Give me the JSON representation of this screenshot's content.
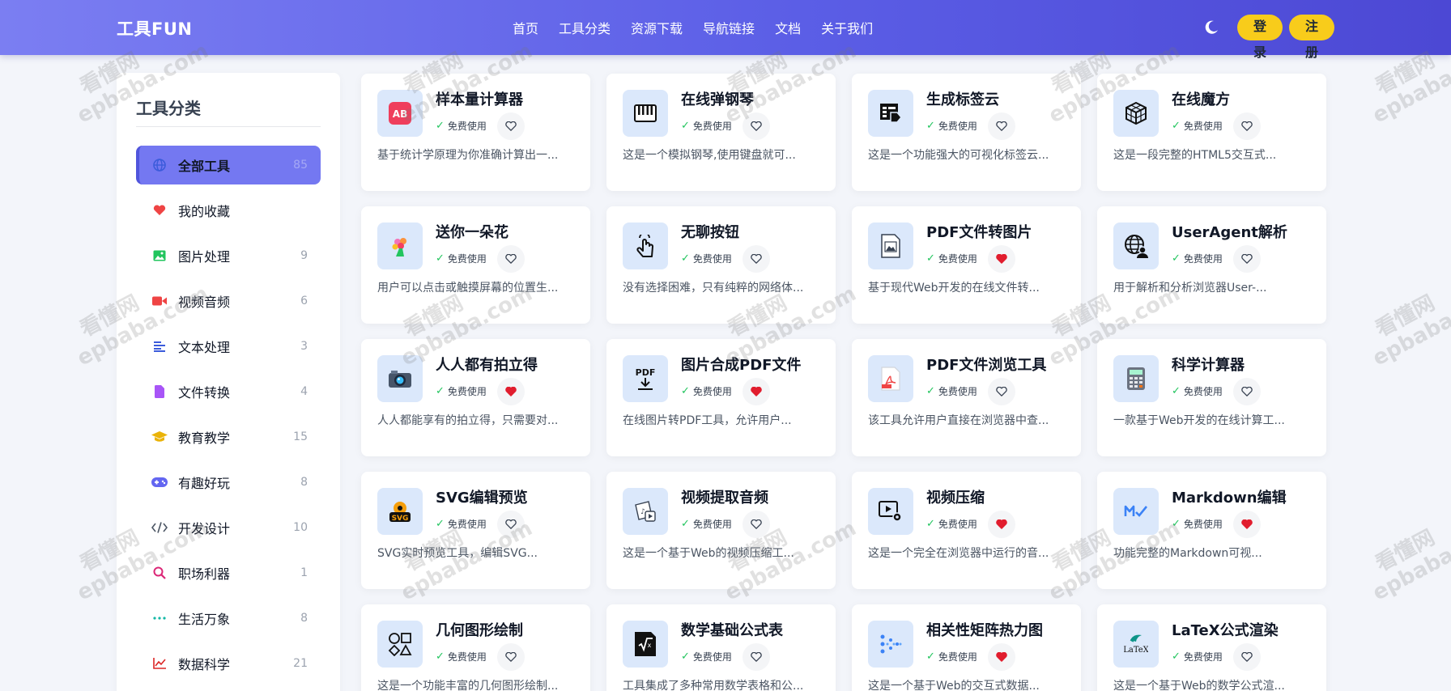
{
  "header": {
    "logo": "工具FUN",
    "nav": [
      "首页",
      "工具分类",
      "资源下载",
      "导航链接",
      "文档",
      "关于我们"
    ],
    "login": "登录",
    "register": "注册"
  },
  "sidebar": {
    "title": "工具分类",
    "items": [
      {
        "label": "全部工具",
        "count": "85",
        "icon": "globe-icon"
      },
      {
        "label": "我的收藏",
        "count": "",
        "icon": "heart-icon"
      },
      {
        "label": "图片处理",
        "count": "9",
        "icon": "image-icon"
      },
      {
        "label": "视频音频",
        "count": "6",
        "icon": "video-icon"
      },
      {
        "label": "文本处理",
        "count": "3",
        "icon": "text-align-icon"
      },
      {
        "label": "文件转换",
        "count": "4",
        "icon": "file-icon"
      },
      {
        "label": "教育教学",
        "count": "15",
        "icon": "graduation-cap-icon"
      },
      {
        "label": "有趣好玩",
        "count": "8",
        "icon": "gamepad-icon"
      },
      {
        "label": "开发设计",
        "count": "10",
        "icon": "code-icon"
      },
      {
        "label": "职场利器",
        "count": "1",
        "icon": "search-icon"
      },
      {
        "label": "生活万象",
        "count": "8",
        "icon": "dots-icon"
      },
      {
        "label": "数据科学",
        "count": "21",
        "icon": "chart-line-icon"
      }
    ]
  },
  "cards": [
    {
      "title": "样本量计算器",
      "free": "免费使用",
      "desc": "基于统计学原理为你准确计算出一...",
      "fav": false,
      "icon": "ab-test-icon"
    },
    {
      "title": "在线弹钢琴",
      "free": "免费使用",
      "desc": "这是一个模拟钢琴,使用键盘就可...",
      "fav": false,
      "icon": "piano-icon"
    },
    {
      "title": "生成标签云",
      "free": "免费使用",
      "desc": "这是一个功能强大的可视化标签云...",
      "fav": false,
      "icon": "tag-table-icon"
    },
    {
      "title": "在线魔方",
      "free": "免费使用",
      "desc": "这是一段完整的HTML5交互式...",
      "fav": false,
      "icon": "cube-icon"
    },
    {
      "title": "送你一朵花",
      "free": "免费使用",
      "desc": "用户可以点击或触摸屏幕的位置生...",
      "fav": false,
      "icon": "flower-icon"
    },
    {
      "title": "无聊按钮",
      "free": "免费使用",
      "desc": "没有选择困难，只有纯粹的网络体...",
      "fav": false,
      "icon": "tap-hand-icon"
    },
    {
      "title": "PDF文件转图片",
      "free": "免费使用",
      "desc": "基于现代Web开发的在线文件转...",
      "fav": true,
      "icon": "picture-file-icon"
    },
    {
      "title": "UserAgent解析",
      "free": "免费使用",
      "desc": "用于解析和分析浏览器User-...",
      "fav": false,
      "icon": "globe-user-icon"
    },
    {
      "title": "人人都有拍立得",
      "free": "免费使用",
      "desc": "人人都能享有的拍立得，只需要对...",
      "fav": true,
      "icon": "camera-icon"
    },
    {
      "title": "图片合成PDF文件",
      "free": "免费使用",
      "desc": "在线图片转PDF工具，允许用户...",
      "fav": true,
      "icon": "pdf-download-icon"
    },
    {
      "title": "PDF文件浏览工具",
      "free": "免费使用",
      "desc": "该工具允许用户直接在浏览器中查...",
      "fav": false,
      "icon": "pdf-file-icon"
    },
    {
      "title": "科学计算器",
      "free": "免费使用",
      "desc": "一款基于Web开发的在线计算工...",
      "fav": false,
      "icon": "calculator-icon"
    },
    {
      "title": "SVG编辑预览",
      "free": "免费使用",
      "desc": "SVG实时预览工具，编辑SVG...",
      "fav": false,
      "icon": "svg-icon"
    },
    {
      "title": "视频提取音频",
      "free": "免费使用",
      "desc": "这是一个基于Web的视频压缩工...",
      "fav": false,
      "icon": "audio-extract-icon"
    },
    {
      "title": "视频压缩",
      "free": "免费使用",
      "desc": "这是一个完全在浏览器中运行的音...",
      "fav": true,
      "icon": "video-settings-icon"
    },
    {
      "title": "Markdown编辑",
      "free": "免费使用",
      "desc": "功能完整的Markdown可视...",
      "fav": true,
      "icon": "markdown-icon"
    },
    {
      "title": "几何图形绘制",
      "free": "免费使用",
      "desc": "这是一个功能丰富的几何图形绘制...",
      "fav": false,
      "icon": "shapes-icon"
    },
    {
      "title": "数学基础公式表",
      "free": "免费使用",
      "desc": "工具集成了多种常用数学表格和公...",
      "fav": false,
      "icon": "sqrt-icon"
    },
    {
      "title": "相关性矩阵热力图",
      "free": "免费使用",
      "desc": "这是一个基于Web的交互式数据...",
      "fav": true,
      "icon": "dot-matrix-icon"
    },
    {
      "title": "LaTeX公式渲染",
      "free": "免费使用",
      "desc": "这是一个基于Web的数学公式渲...",
      "fav": false,
      "icon": "latex-icon"
    }
  ],
  "watermark": {
    "line1": "看懂网",
    "line2": "epbaba.com"
  }
}
